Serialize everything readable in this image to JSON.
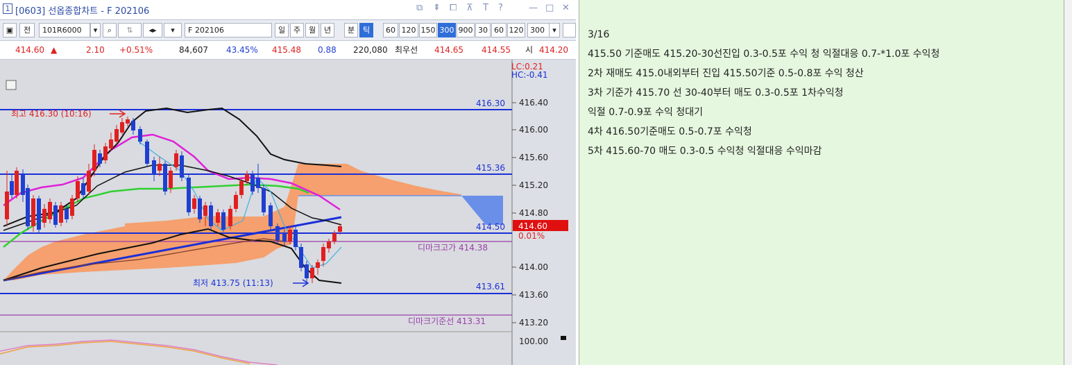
{
  "window": {
    "number": "1",
    "title": "[0603] 선옵종합차트 - F 202106",
    "controls": [
      "⧉",
      "⇞",
      "⧠",
      "⊼",
      "T",
      "?",
      "—",
      "□",
      "✕"
    ]
  },
  "toolbar": {
    "prev_label": "전",
    "code": "101R6000",
    "search_icon": "search-icon",
    "symbol": "F 202106",
    "periods": [
      "일",
      "주",
      "월",
      "년",
      "분",
      "틱"
    ],
    "active_period": "틱",
    "intervals": [
      "60",
      "120",
      "150",
      "300",
      "900",
      "30",
      "60",
      "120"
    ],
    "active_interval": "300",
    "interval_select": "300"
  },
  "quote": {
    "price": "414.60",
    "arrow": "▲",
    "change": "2.10",
    "change_pct": "+0.51%",
    "volume": "84,607",
    "volume_pct": "43.45%",
    "v1": "415.48",
    "v2": "0.88",
    "v3": "220,080",
    "best_label": "최우선",
    "ask": "414.65",
    "bid": "414.55",
    "open_label": "시",
    "open": "414.20"
  },
  "chart": {
    "lc": "LC:0.21",
    "hc": "HC:-0.41",
    "high_label": "최고 416.30 (10:16)",
    "low_label": "최저 413.75 (11:13)",
    "line_labels": [
      "416.30",
      "415.36",
      "414.50",
      "413.61"
    ],
    "dimark_high": "디마크고가 414.38",
    "dimark_base": "디마크기준선 413.31",
    "current_price": "414.60",
    "current_pct": "0.01%",
    "axis_ticks": [
      "416.40",
      "416.00",
      "415.60",
      "415.20",
      "414.80",
      "414.00",
      "413.60",
      "413.20"
    ],
    "osc_tick": "100.00"
  },
  "notes": [
    "3/16",
    "415.50 기준매도  415.20-30선진입   0.3-0.5포 수익 청 익절대응 0.7-*1.0포 수익청",
    "2차 재매도 415.0내외부터 진입 415.50기준   0.5-0.8포 수익 청산",
    "3차 기준가 415.70     선 30-40부터 매도  0.3-0.5포 1차수익청",
    "  익절 0.7-0.9포 수익 청대기",
    "4차 416.50기준매도    0.5-0.7포 수익청",
    "5차  415.60-70 매도 0.3-0.5 수익청 익절대응     수익마감"
  ],
  "colors": {
    "up": "#e02020",
    "down": "#1f3fd0",
    "cloud": "#f5a06e",
    "note_bg": "#e5f7df"
  }
}
